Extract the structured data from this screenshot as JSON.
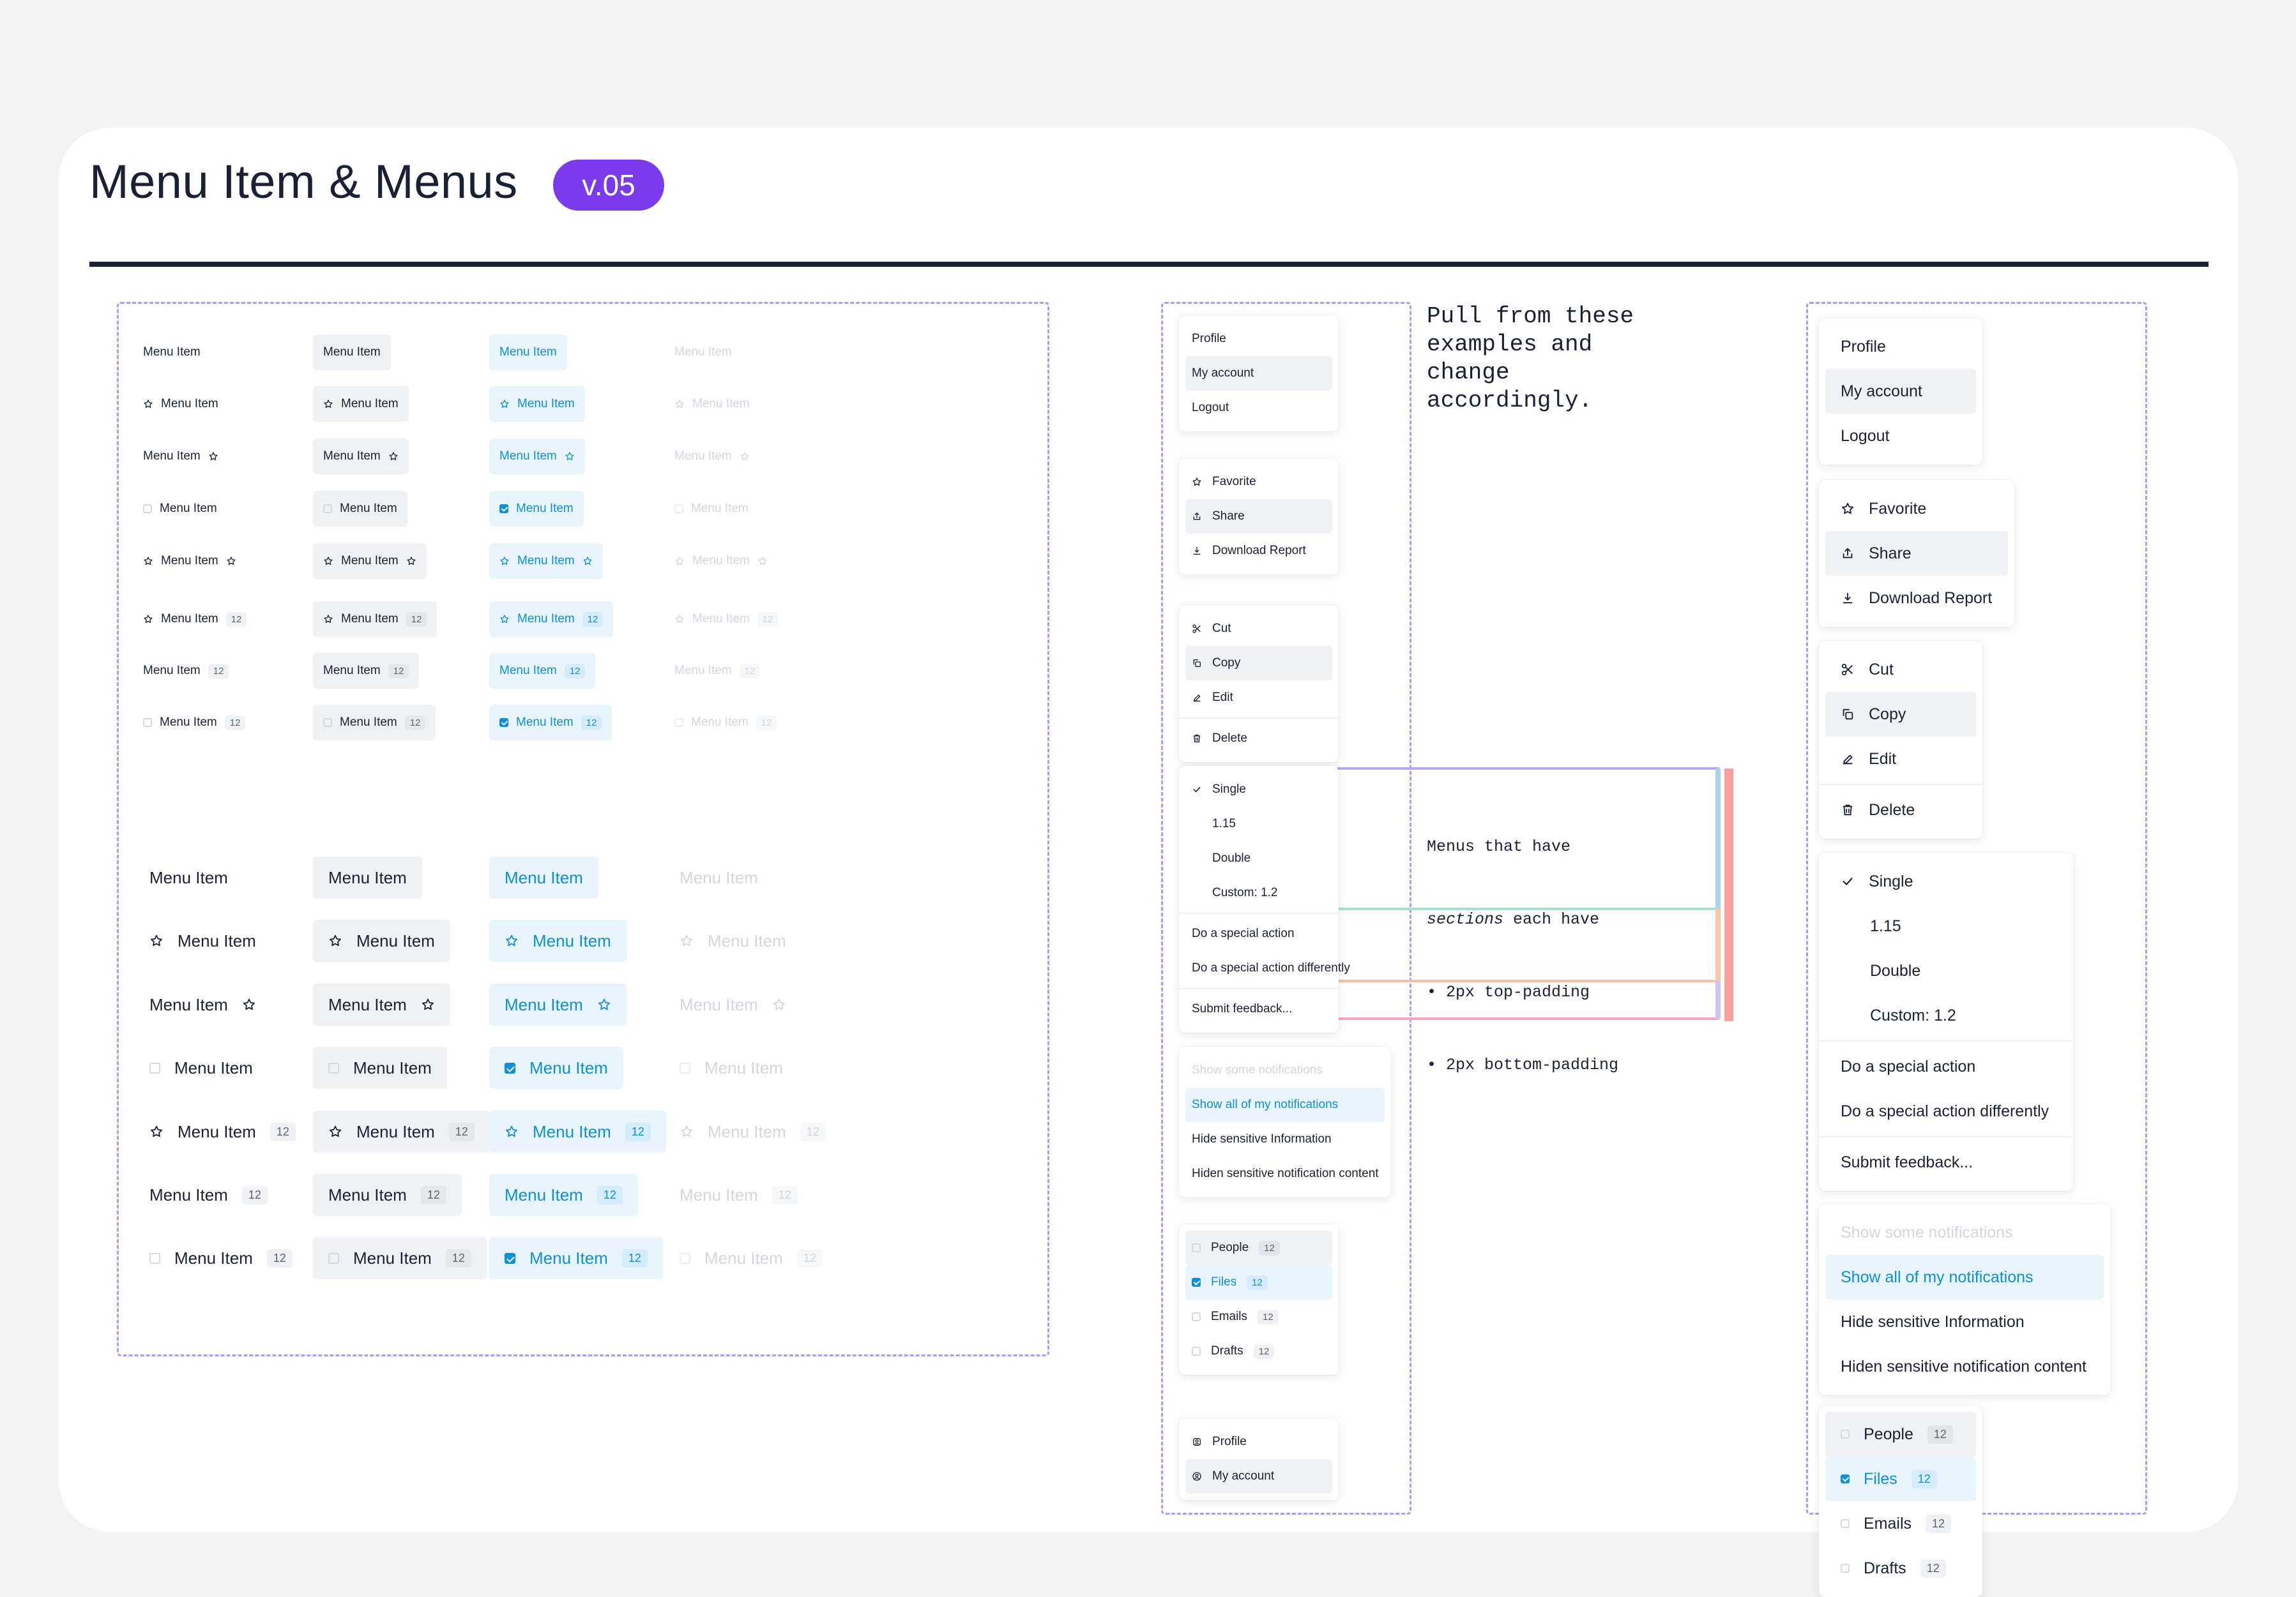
{
  "page": {
    "title": "Menu Item & Menus",
    "version": "v.05",
    "note_pull": "Pull from these\nexamples and\nchange\naccordingly.",
    "note_sections_line1": "Menus that have",
    "note_sections_em": "sections",
    "note_sections_line2_rest": " each have",
    "note_sections_b1": "• 2px top-padding",
    "note_sections_b2": "• 2px bottom-padding"
  },
  "variants": {
    "label": "Menu Item",
    "badge": "12"
  },
  "menus": {
    "account": [
      "Profile",
      "My account",
      "Logout"
    ],
    "actions": [
      "Favorite",
      "Share",
      "Download Report"
    ],
    "edit": [
      "Cut",
      "Copy",
      "Edit",
      "Delete"
    ],
    "spacing": [
      "Single",
      "1.15",
      "Double",
      "Custom: 1.2"
    ],
    "special": [
      "Do a special action",
      "Do a special action differently"
    ],
    "feedback": "Submit feedback...",
    "notifications": [
      "Show some notifications",
      "Show all of my notifications",
      "Hide sensitive Information",
      "Hiden sensitive notification content"
    ],
    "folders": [
      {
        "label": "People",
        "badge": "12"
      },
      {
        "label": "Files",
        "badge": "12"
      },
      {
        "label": "Emails",
        "badge": "12"
      },
      {
        "label": "Drafts",
        "badge": "12"
      }
    ],
    "profile2": [
      "Profile",
      "My account"
    ]
  },
  "colors": {
    "accent": "#7c3aed",
    "selected_text": "#0e8fd8",
    "selected_bg": "#e8f5fd",
    "hover_bg": "#f0f1f4",
    "frame_dash": "#a99cf5"
  }
}
